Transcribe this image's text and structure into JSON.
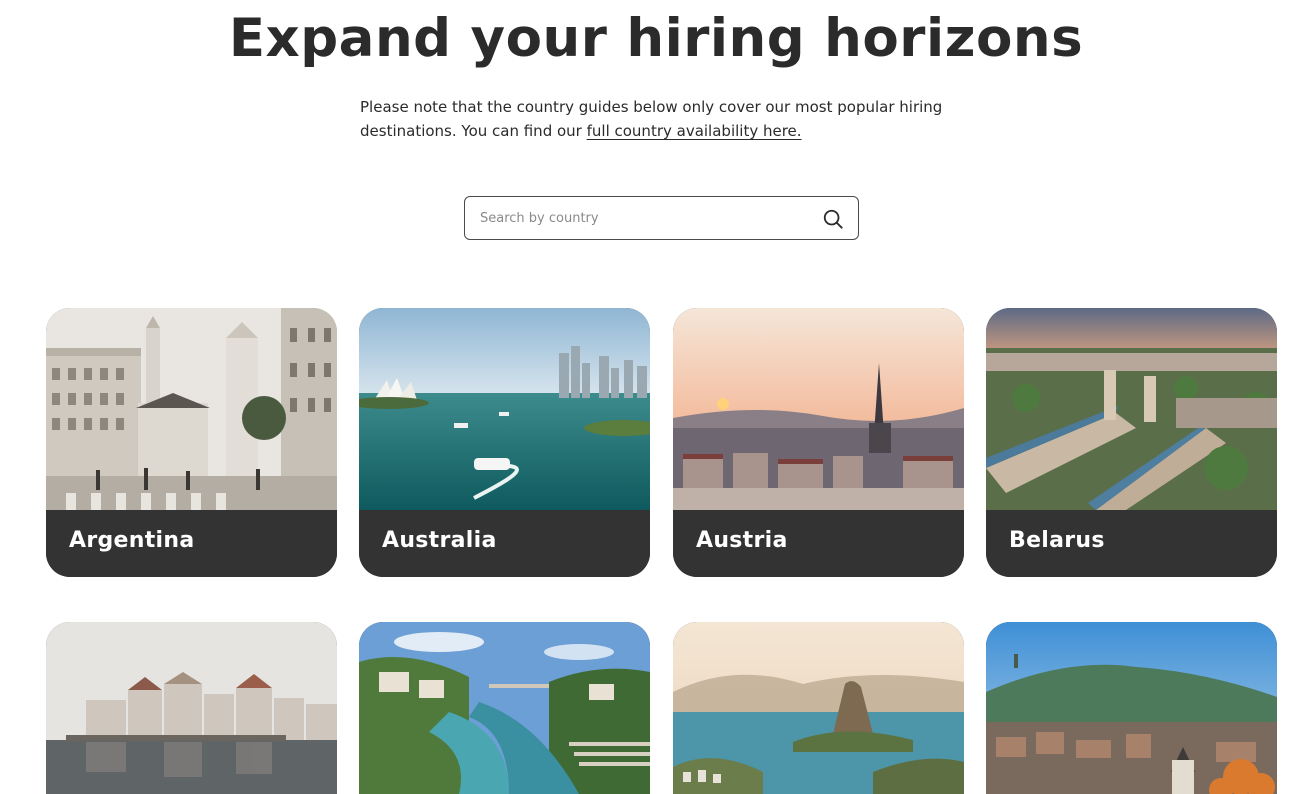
{
  "header": {
    "title": "Expand your hiring horizons",
    "subtitle_text": "Please note that the country guides below only cover our most popular hiring destinations. You can find our ",
    "subtitle_link": "full country availability here."
  },
  "search": {
    "placeholder": "Search by country",
    "icon": "search-icon"
  },
  "countries": [
    {
      "name": "Argentina"
    },
    {
      "name": "Australia"
    },
    {
      "name": "Austria"
    },
    {
      "name": "Belarus"
    },
    {
      "name": ""
    },
    {
      "name": ""
    },
    {
      "name": ""
    },
    {
      "name": ""
    }
  ],
  "colors": {
    "text": "#2b2b2b",
    "card_label_bg": "#333333",
    "card_label_text": "#ffffff"
  }
}
